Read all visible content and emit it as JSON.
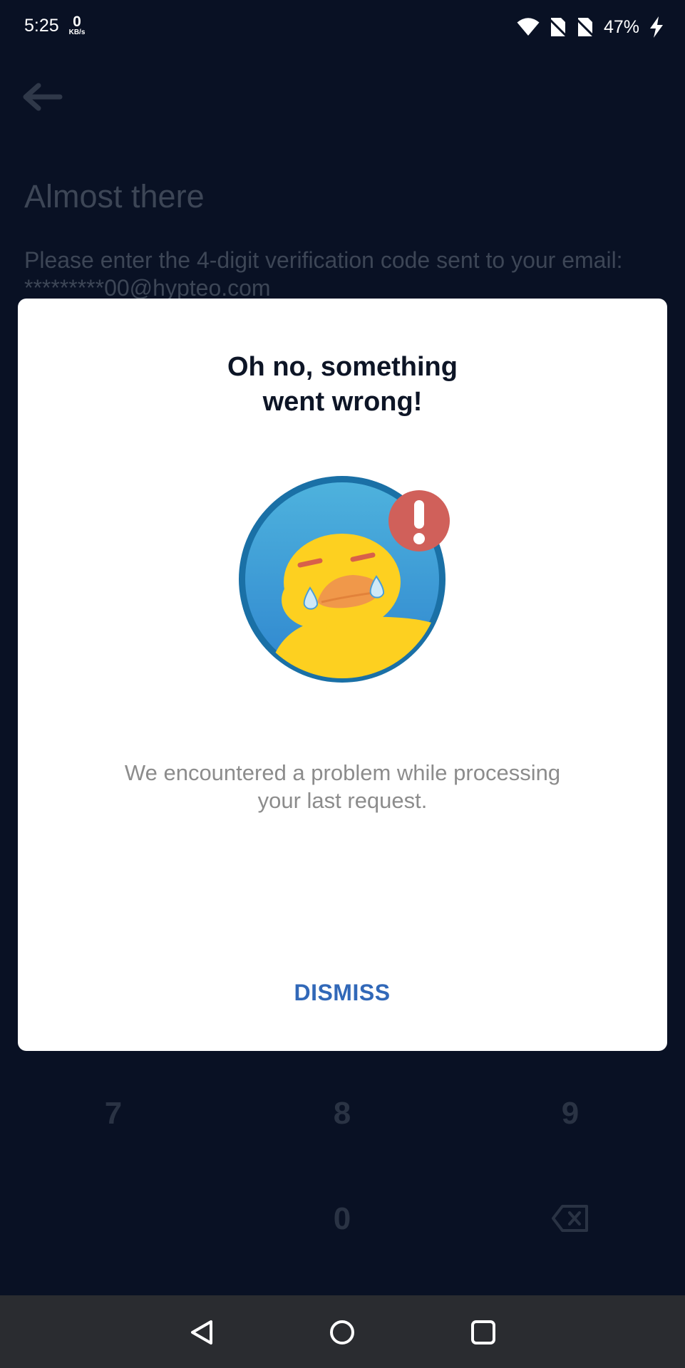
{
  "status_bar": {
    "time": "5:25",
    "net_speed_value": "0",
    "net_speed_unit": "KB/s",
    "battery_percent": "47%",
    "icons": [
      "wifi-icon",
      "no-sim-icon",
      "no-sim-icon",
      "charging-bolt-icon"
    ]
  },
  "background_screen": {
    "back_icon": "arrow-left-icon",
    "title": "Almost there",
    "instruction": "Please enter the 4-digit verification code sent to your email: *********00@hypteo.com",
    "keypad": {
      "key_7": "7",
      "key_8": "8",
      "key_9": "9",
      "key_0": "0",
      "backspace_icon": "backspace-icon"
    }
  },
  "dialog": {
    "title_line1": "Oh no, something",
    "title_line2": "went wrong!",
    "illustration": "crying-duck-error-illustration",
    "message_line1": "We encountered a problem while processing",
    "message_line2": "your last request.",
    "dismiss_label": "DISMISS"
  },
  "nav_bar": {
    "icons": [
      "back-triangle-icon",
      "home-circle-icon",
      "recents-square-icon"
    ]
  },
  "colors": {
    "background": "#091124",
    "dialog_bg": "#ffffff",
    "accent": "#3168b8",
    "error_badge": "#d0605a",
    "duck_yellow": "#fdd020"
  }
}
